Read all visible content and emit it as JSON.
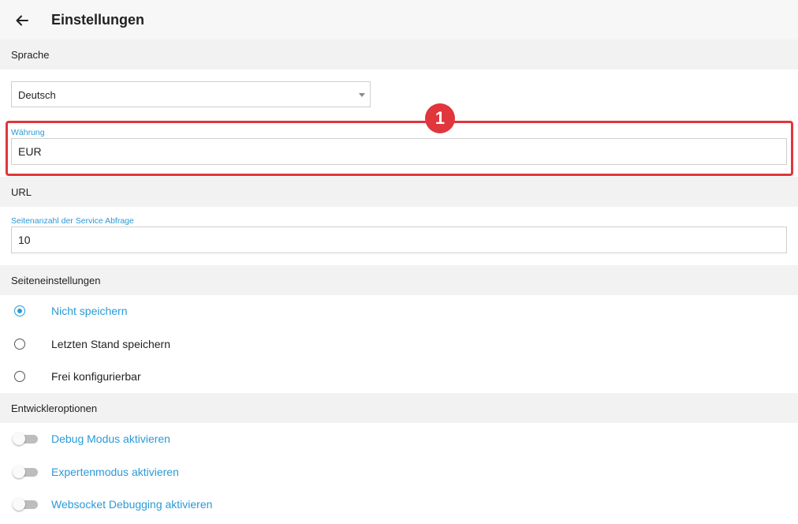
{
  "header": {
    "title": "Einstellungen",
    "back_icon": "arrow-left-icon"
  },
  "sections": {
    "language": "Sprache",
    "url": "URL",
    "page_settings": "Seiteneinstellungen",
    "developer": "Entwickleroptionen"
  },
  "language_select": {
    "value": "Deutsch"
  },
  "currency": {
    "label": "Währung",
    "value": "EUR"
  },
  "page_count": {
    "label": "Seitenanzahl der Service Abfrage",
    "value": "10"
  },
  "annotation": {
    "number": "1",
    "color": "#e0363c"
  },
  "page_options": [
    {
      "label": "Nicht speichern",
      "checked": true
    },
    {
      "label": "Letzten Stand speichern",
      "checked": false
    },
    {
      "label": "Frei konfigurierbar",
      "checked": false
    }
  ],
  "developer_options": [
    {
      "label": "Debug Modus aktivieren",
      "enabled": false
    },
    {
      "label": "Expertenmodus aktivieren",
      "enabled": false
    },
    {
      "label": "Websocket Debugging aktivieren",
      "enabled": false
    }
  ],
  "colors": {
    "accent": "#2b9ad6",
    "section_bg": "#f2f2f2"
  }
}
